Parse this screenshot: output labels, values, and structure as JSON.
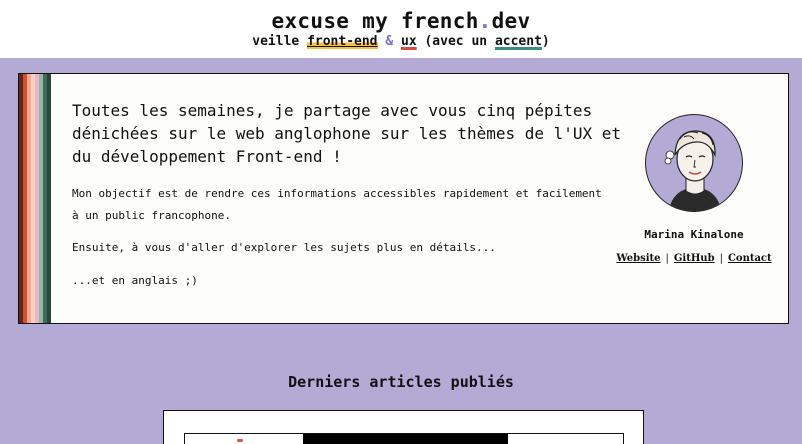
{
  "header": {
    "title_main": "excuse my french",
    "title_dot": ".",
    "title_tld": "dev",
    "tagline": {
      "prefix": "veille ",
      "front_end": "front-end",
      "amp": " & ",
      "ux": "ux",
      "middle": " (avec un ",
      "accent": "accent",
      "suffix": ")"
    }
  },
  "intro": {
    "lead": "Toutes les semaines, je partage avec vous cinq pépites dénichées sur le web anglophone sur les thèmes de l'UX et du développement Front-end !",
    "p1": "Mon objectif est de rendre ces informations accessibles rapidement et facilement à un public francophone.",
    "p2": "Ensuite, à vous d'aller d'explorer les sujets plus en détails...",
    "p3": "...et en anglais ;)"
  },
  "author": {
    "name": "Marina Kinalone",
    "links": [
      "Website",
      "GitHub",
      "Contact"
    ],
    "separator": "|"
  },
  "latest": {
    "title": "Derniers articles publiés"
  },
  "colors": {
    "accent_purple": "#b3abd6",
    "stripes": [
      "#5a2a1a",
      "#d94a38",
      "#f2a98a",
      "#f7d0c0",
      "#e8b7c8",
      "#9ab5a6",
      "#3d6b5e",
      "#27473d"
    ]
  }
}
